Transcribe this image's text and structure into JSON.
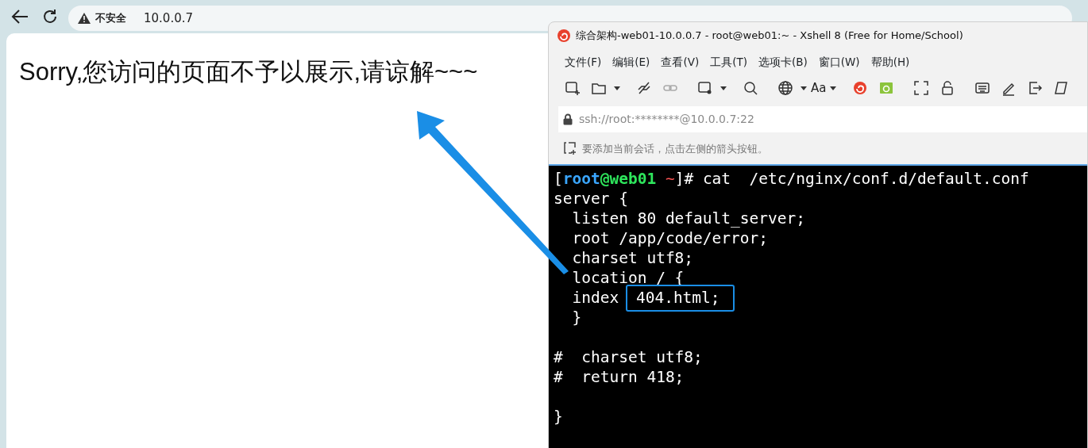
{
  "browser": {
    "security_label": "不安全",
    "url": "10.0.0.7",
    "page_text": "Sorry,您访问的页面不予以展示,请谅解~~~"
  },
  "xshell": {
    "title": "综合架构-web01-10.0.0.7 - root@web01:~ - Xshell 8 (Free for Home/School)",
    "menu": [
      "文件(F)",
      "编辑(E)",
      "查看(V)",
      "工具(T)",
      "选项卡(B)",
      "窗口(W)",
      "帮助(H)"
    ],
    "font_button_label": "Aa",
    "address": "ssh://root:********@10.0.0.7:22",
    "hint": "要添加当前会话，点击左侧的箭头按钮。",
    "terminal_lines": [
      {
        "kind": "text",
        "segments": [
          {
            "text": "[",
            "color": "#ffffff"
          },
          {
            "text": "root",
            "color": "#3aa6ff",
            "bold": true
          },
          {
            "text": "@web01",
            "color": "#2ee65c",
            "bold": true
          },
          {
            "text": " ~",
            "color": "#ff5555"
          },
          {
            "text": "]# cat  /etc/nginx/conf.d/default.conf",
            "color": "#ffffff"
          }
        ]
      },
      {
        "kind": "text",
        "segments": [
          {
            "text": "server {",
            "color": "#ffffff"
          }
        ]
      },
      {
        "kind": "text",
        "segments": [
          {
            "text": "  listen 80 default_server;",
            "color": "#ffffff"
          }
        ]
      },
      {
        "kind": "text",
        "segments": [
          {
            "text": "  root /app/code/error;",
            "color": "#ffffff"
          }
        ]
      },
      {
        "kind": "text",
        "segments": [
          {
            "text": "  charset utf8;",
            "color": "#ffffff"
          }
        ]
      },
      {
        "kind": "text",
        "segments": [
          {
            "text": "  location / {",
            "color": "#ffffff"
          }
        ]
      },
      {
        "kind": "text",
        "segments": [
          {
            "text": "  index ",
            "color": "#ffffff"
          },
          {
            "text": "404.html;",
            "color": "#ffffff",
            "annotated": true
          }
        ]
      },
      {
        "kind": "text",
        "segments": [
          {
            "text": "  }",
            "color": "#ffffff"
          }
        ]
      },
      {
        "kind": "blank"
      },
      {
        "kind": "text",
        "segments": [
          {
            "text": "#  charset utf8;",
            "color": "#ffffff"
          }
        ]
      },
      {
        "kind": "text",
        "segments": [
          {
            "text": "#  return 418;",
            "color": "#ffffff"
          }
        ]
      },
      {
        "kind": "blank"
      },
      {
        "kind": "text",
        "segments": [
          {
            "text": "}",
            "color": "#ffffff"
          }
        ]
      }
    ]
  }
}
